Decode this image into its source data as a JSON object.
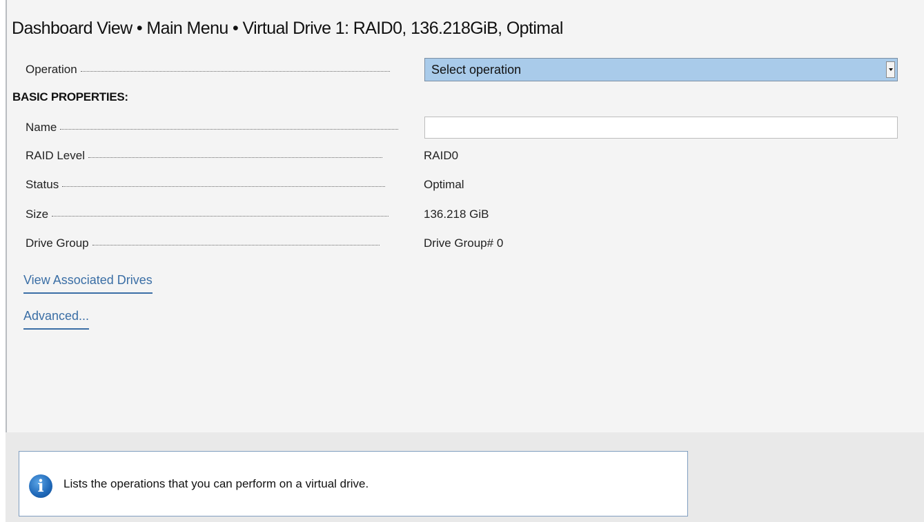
{
  "header": {
    "title": "Dashboard View • Main Menu • Virtual Drive 1: RAID0, 136.218GiB, Optimal"
  },
  "operation": {
    "label": "Operation",
    "selected": "Select operation"
  },
  "basic_properties": {
    "heading": "BASIC PROPERTIES:",
    "name": {
      "label": "Name",
      "value": ""
    },
    "raid_level": {
      "label": "RAID Level",
      "value": "RAID0"
    },
    "status": {
      "label": "Status",
      "value": "Optimal"
    },
    "size": {
      "label": "Size",
      "value": "136.218 GiB"
    },
    "drive_group": {
      "label": "Drive Group",
      "value": "Drive Group# 0"
    }
  },
  "links": {
    "view_associated_drives": "View Associated Drives",
    "advanced": "Advanced..."
  },
  "help": {
    "icon": "info-icon",
    "icon_glyph": "i",
    "text": "Lists the operations that you can perform on a virtual drive."
  },
  "colors": {
    "select_background": "#a9cbea",
    "link": "#3a6ea5",
    "info_icon": "#1f68b8"
  }
}
